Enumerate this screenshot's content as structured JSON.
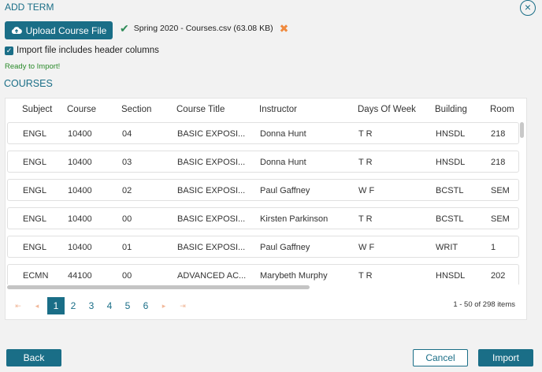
{
  "header": {
    "title": "ADD TERM"
  },
  "upload": {
    "button_label": "Upload Course File",
    "file_name": "Spring 2020 - Courses.csv (63.08 KB)"
  },
  "options": {
    "header_columns_label": "Import file includes header columns",
    "header_columns_checked": true
  },
  "status": {
    "ready_text": "Ready to Import!"
  },
  "section_title": "COURSES",
  "table": {
    "columns": [
      "Subject",
      "Course",
      "Section",
      "Course Title",
      "Instructor",
      "Days Of Week",
      "Building",
      "Room"
    ],
    "rows": [
      [
        "ENGL",
        "10400",
        "04",
        "BASIC EXPOSI...",
        "Donna Hunt",
        "T R",
        "HNSDL",
        "218"
      ],
      [
        "ENGL",
        "10400",
        "03",
        "BASIC EXPOSI...",
        "Donna Hunt",
        "T R",
        "HNSDL",
        "218"
      ],
      [
        "ENGL",
        "10400",
        "02",
        "BASIC EXPOSI...",
        "Paul Gaffney",
        "W F",
        "BCSTL",
        "SEM"
      ],
      [
        "ENGL",
        "10400",
        "00",
        "BASIC EXPOSI...",
        "Kirsten Parkinson",
        "T R",
        "BCSTL",
        "SEM"
      ],
      [
        "ENGL",
        "10400",
        "01",
        "BASIC EXPOSI...",
        "Paul Gaffney",
        "W F",
        "WRIT",
        "1"
      ],
      [
        "ECMN",
        "44100",
        "00",
        "ADVANCED AC...",
        "Marybeth Murphy",
        "T R",
        "HNSDL",
        "202"
      ]
    ]
  },
  "pagination": {
    "first": "⇤",
    "prev": "◂",
    "next": "▸",
    "last": "⇥",
    "pages": [
      "1",
      "2",
      "3",
      "4",
      "5",
      "6"
    ],
    "active_page": "1",
    "summary": "1 - 50 of 298 items"
  },
  "footer": {
    "back_label": "Back",
    "cancel_label": "Cancel",
    "import_label": "Import"
  },
  "colors": {
    "accent": "#1a6e87",
    "success": "#2a8a2a",
    "warning": "#f08a3e"
  }
}
